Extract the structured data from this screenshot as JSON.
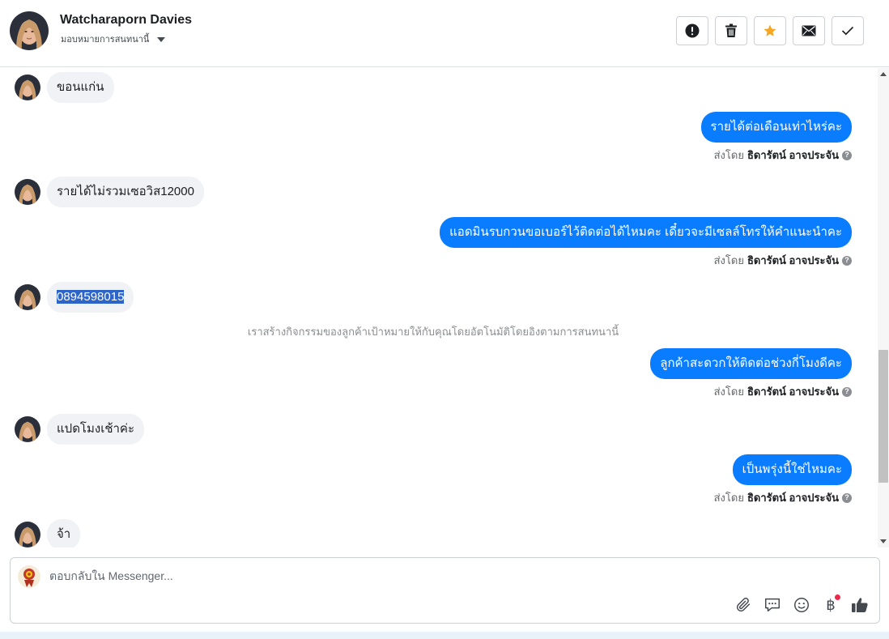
{
  "header": {
    "name": "Watcharaporn Davies",
    "assign_label": "มอบหมายการสนทนานี้",
    "buttons": [
      {
        "name": "mark-spam-button",
        "icon": "alert-icon"
      },
      {
        "name": "delete-button",
        "icon": "trash-icon"
      },
      {
        "name": "star-button",
        "icon": "star-icon"
      },
      {
        "name": "mark-unread-button",
        "icon": "envelope-icon"
      },
      {
        "name": "mark-done-button",
        "icon": "check-icon"
      }
    ]
  },
  "messages": {
    "m1": {
      "text": "ขอนแก่น"
    },
    "m2": {
      "text": "รายได้ต่อเดือนเท่าไหร่คะ",
      "sent_by_label": "ส่งโดย",
      "sender": "ธิดารัตน์ อาจประจัน"
    },
    "m3": {
      "text": "รายได้ไม่รวมเซอวิส12000"
    },
    "m4": {
      "text": "แอดมินรบกวนขอเบอร์ไว้ติดต่อได้ไหมคะ เดี๋ยวจะมีเซลล์โทรให้คำแนะนำคะ",
      "sent_by_label": "ส่งโดย",
      "sender": "ธิดารัตน์ อาจประจัน"
    },
    "m5": {
      "text": "0894598015"
    },
    "system_note": "เราสร้างกิจกรรมของลูกค้าเป้าหมายให้กับคุณโดยอัตโนมัติโดยอิงตามการสนทนานี้",
    "m6": {
      "text": "ลูกค้าสะดวกให้ติดต่อช่วงกี่โมงดีคะ",
      "sent_by_label": "ส่งโดย",
      "sender": "ธิดารัตน์ อาจประจัน"
    },
    "m7": {
      "text": "แปดโมงเช้าค่ะ"
    },
    "m8": {
      "text": "เป็นพรุ่งนี้ใช่ไหมคะ",
      "sent_by_label": "ส่งโดย",
      "sender": "ธิดารัตน์ อาจประจัน"
    },
    "m9": {
      "text": "จ้า"
    }
  },
  "composer": {
    "placeholder": "ตอบกลับใน Messenger...",
    "baht_symbol": "฿",
    "tools": [
      "paperclip-icon",
      "saved-reply-icon",
      "emoji-icon",
      "baht-icon",
      "thumbs-up-icon"
    ]
  },
  "colors": {
    "outgoing_bubble": "#0a7cff",
    "incoming_bubble": "#f0f2f5",
    "star": "#f5a623",
    "selection": "#2d64c8"
  }
}
